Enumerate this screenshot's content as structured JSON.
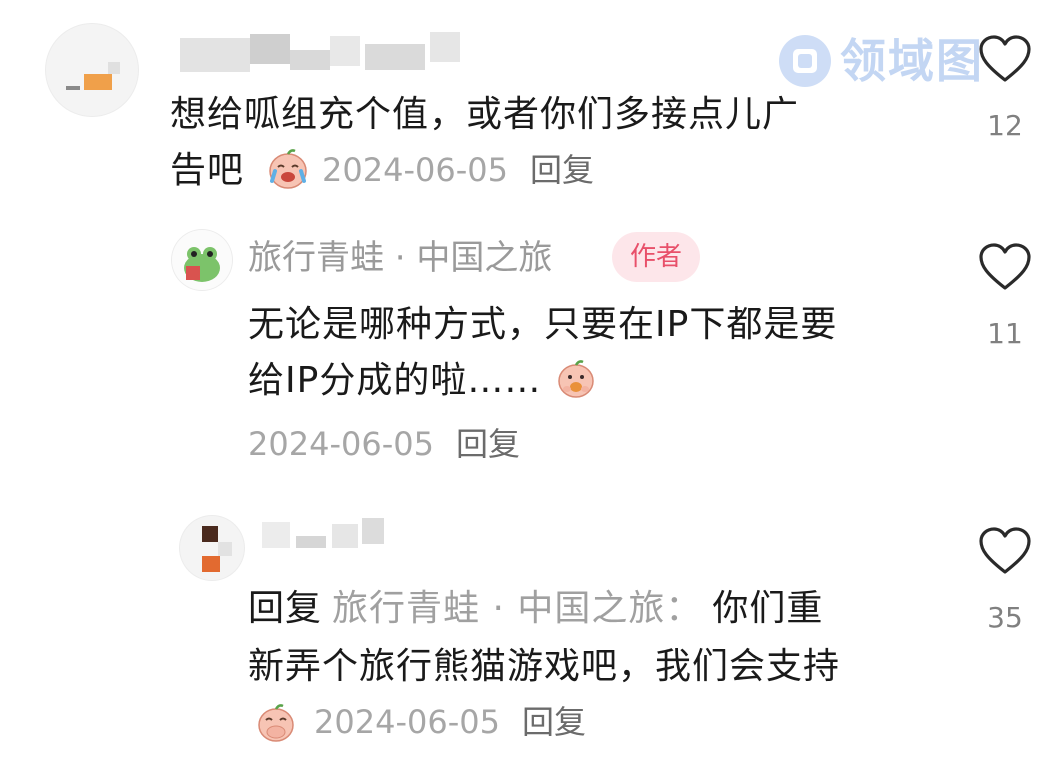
{
  "watermark": {
    "text": "领域图"
  },
  "comments": [
    {
      "text_line1": "想给呱组充个值，或者你们多接点儿广",
      "text_line2": "告吧",
      "date": "2024-06-05",
      "reply_label": "回复",
      "likes": "12",
      "emoji": "crying-laugh-emoji"
    },
    {
      "author": "旅行青蛙 · 中国之旅",
      "badge": "作者",
      "text_line1": "无论是哪种方式，只要在IP下都是要",
      "text_line2": "给IP分成的啦……",
      "date": "2024-06-05",
      "reply_label": "回复",
      "likes": "11",
      "emoji": "eating-emoji"
    },
    {
      "reply_prefix": "回复",
      "reply_target": "旅行青蛙 · 中国之旅：",
      "text_line1_rest": "你们重",
      "text_line2": "新弄个旅行熊猫游戏吧，我们会支持",
      "date": "2024-06-05",
      "reply_label": "回复",
      "likes": "35",
      "emoji": "covering-mouth-emoji"
    }
  ],
  "colors": {
    "badge_bg": "#fde6ea",
    "badge_text": "#e8506a",
    "meta_text": "#a6a6a6",
    "watermark": "#b9cff1"
  }
}
